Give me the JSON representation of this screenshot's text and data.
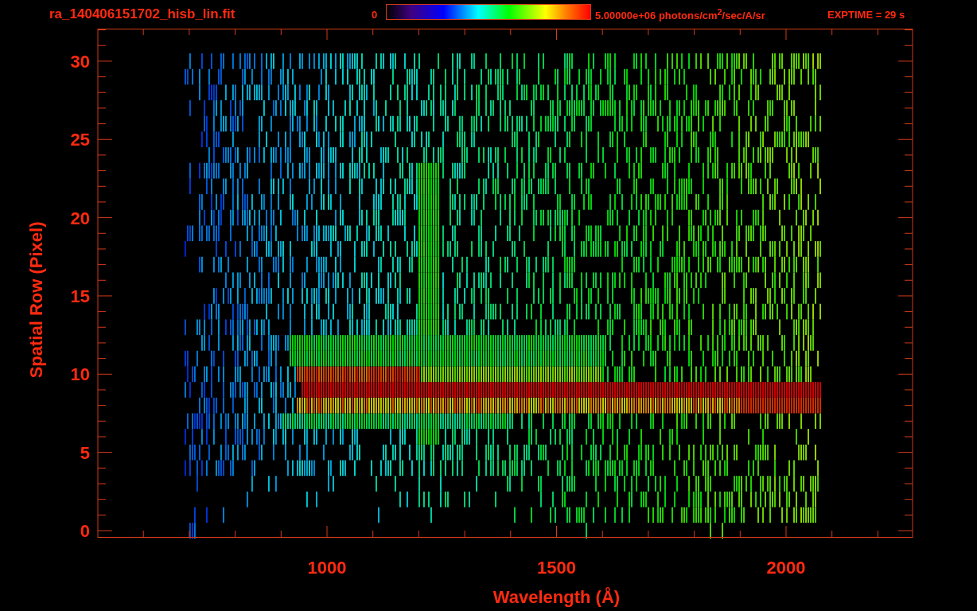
{
  "header": {
    "filename": "ra_140406151702_hisb_lin.fit",
    "colorbar": {
      "min_label": "0",
      "max_label": "5.00000e+06 photons/cm$^{2}$/sec/A/sr"
    },
    "exposure": "EXPTIME = 29 s"
  },
  "plot": {
    "xlabel": "Wavelength (Å)",
    "ylabel": "Spatial Row (Pixel)",
    "xtick_labels": [
      "1000",
      "1500",
      "2000"
    ],
    "ytick_labels": [
      "30",
      "25",
      "20",
      "15",
      "10",
      "5",
      "0"
    ]
  }
}
